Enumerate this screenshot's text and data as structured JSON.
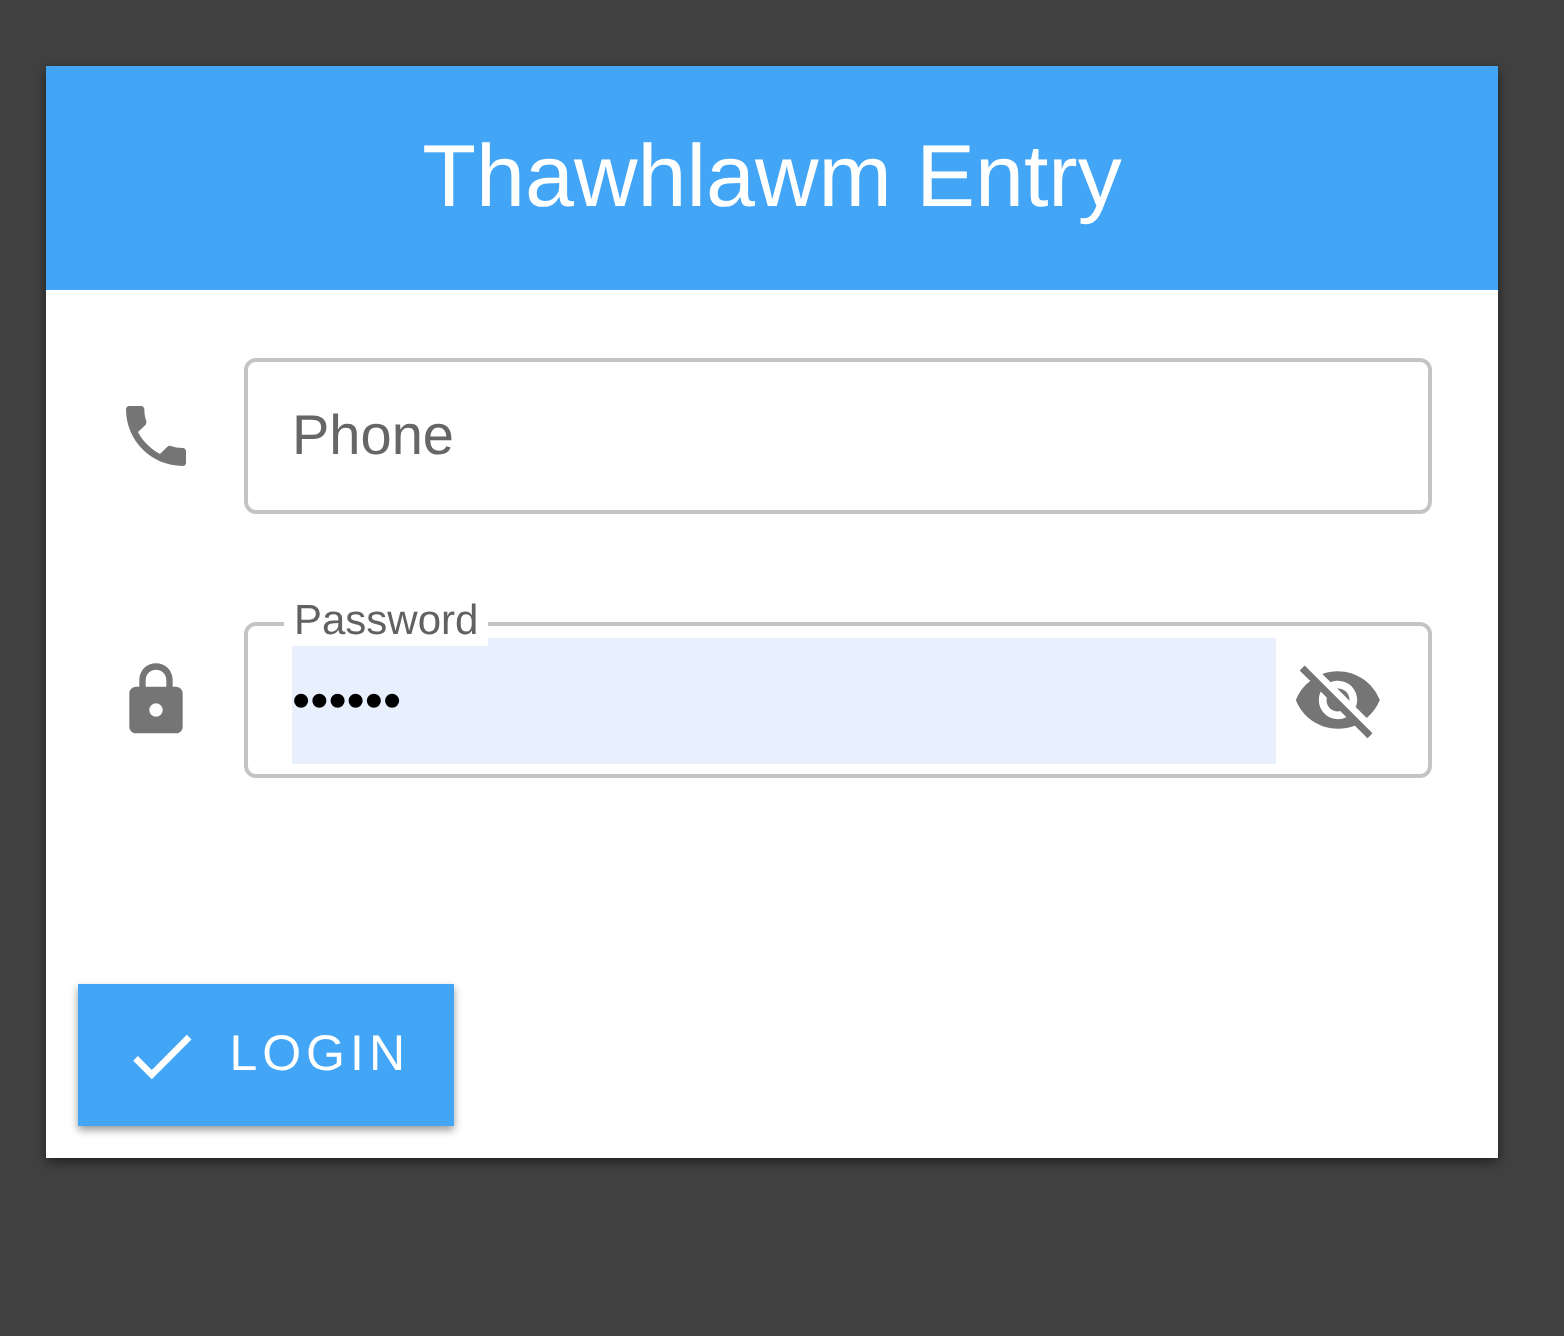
{
  "dialog": {
    "title": "Thawhlawm Entry"
  },
  "fields": [
    {
      "kind": "phone",
      "placeholder": "Phone"
    },
    {
      "kind": "password",
      "label": "Password",
      "value": "••••••",
      "autofilled": true,
      "masked": true
    }
  ],
  "button": {
    "label": "LOGIN"
  }
}
